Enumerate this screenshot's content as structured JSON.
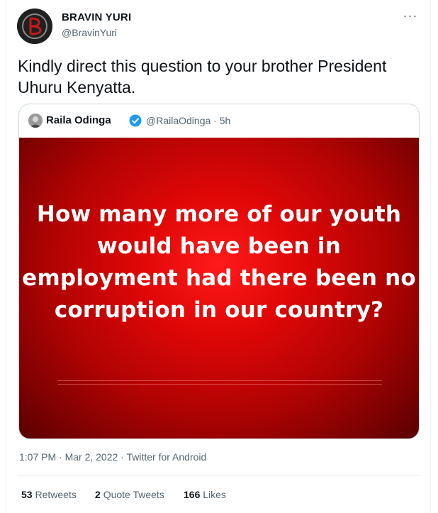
{
  "author": {
    "name": "BRAVIN YURI",
    "handle": "@BravinYuri"
  },
  "more_icon": "more-horizontal-icon",
  "tweet": {
    "text": "Kindly direct this question to your brother President Uhuru Kenyatta."
  },
  "quoted": {
    "name": "Raila Odinga",
    "verified_icon": "verified-badge-icon",
    "handle_time": "@RailaOdinga · 5h",
    "image_text_lines": [
      "How many more of our youth",
      "would have been in",
      "employment had there been no",
      "corruption in our country?"
    ],
    "image_bg_color": "#e00707"
  },
  "meta": "1:07 PM · Mar 2, 2022 · Twitter for Android",
  "stats": [
    {
      "count": "53",
      "label": "Retweets"
    },
    {
      "count": "2",
      "label": "Quote Tweets"
    },
    {
      "count": "166",
      "label": "Likes"
    }
  ],
  "colors": {
    "text": "#0f1419",
    "secondary": "#536471",
    "verified": "#1d9bf0"
  }
}
